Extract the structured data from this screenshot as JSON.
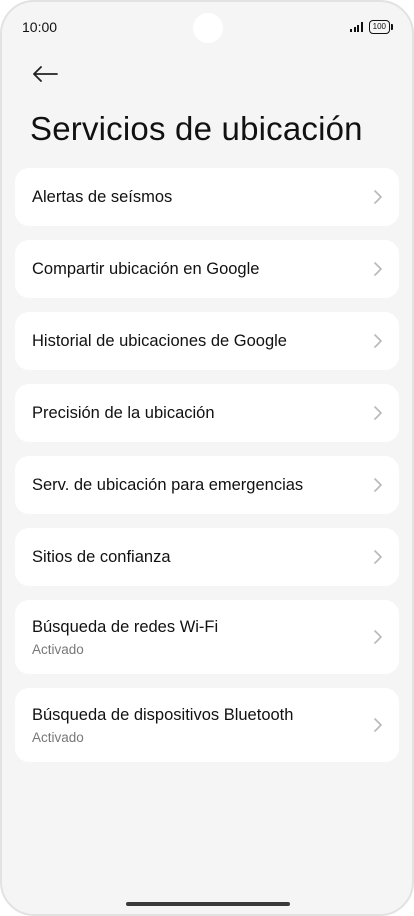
{
  "status_bar": {
    "time": "10:00",
    "battery": "100"
  },
  "header": {
    "back_icon": "back-arrow-icon",
    "title": "Servicios de ubicación"
  },
  "settings": {
    "items": [
      {
        "title": "Alertas de seísmos"
      },
      {
        "title": "Compartir ubicación en Google"
      },
      {
        "title": "Historial de ubicaciones de Google"
      },
      {
        "title": "Precisión de la ubicación"
      },
      {
        "title": "Serv. de ubicación para emergencias"
      },
      {
        "title": "Sitios de confianza"
      },
      {
        "title": "Búsqueda de redes Wi-Fi",
        "subtitle": "Activado"
      },
      {
        "title": "Búsqueda de dispositivos Bluetooth",
        "subtitle": "Activado"
      }
    ]
  },
  "colors": {
    "background": "#f5f5f5",
    "card": "#ffffff",
    "text": "#111111",
    "subtext": "#777777",
    "chevron": "#b8b8b8"
  }
}
